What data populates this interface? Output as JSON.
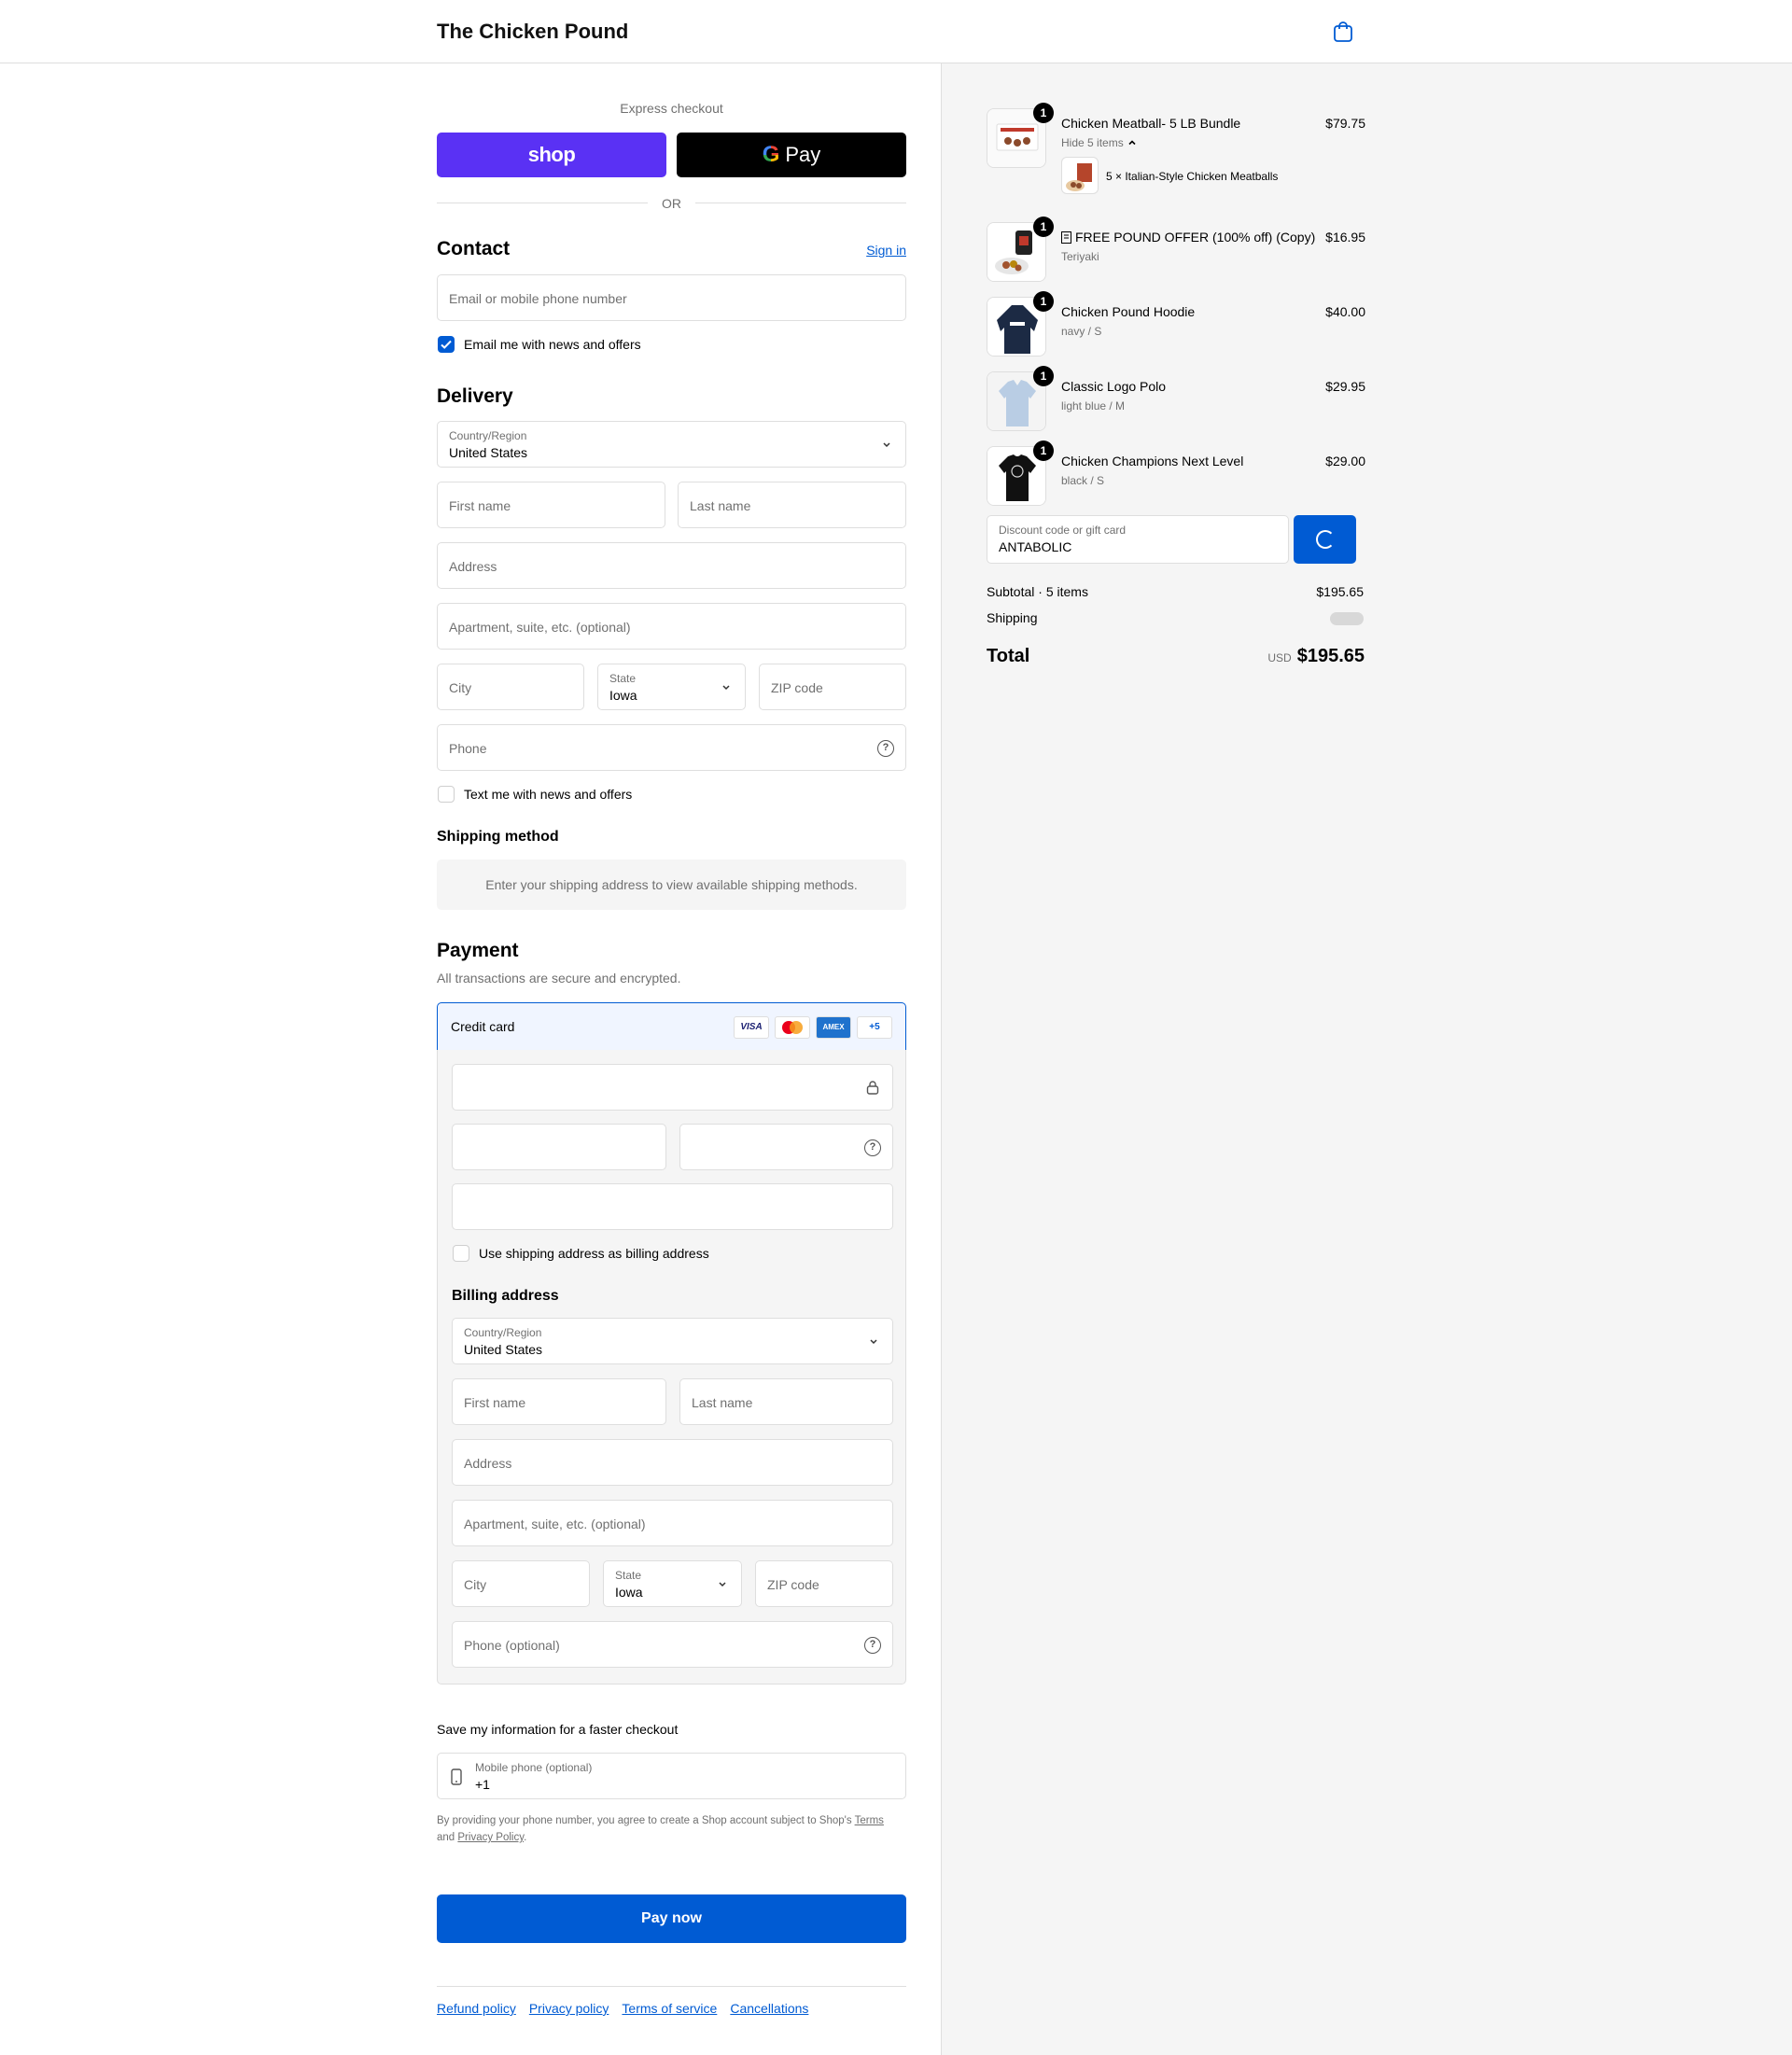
{
  "header": {
    "brand": "The Chicken Pound",
    "cart_icon": "shopping-bag-icon"
  },
  "express": {
    "label": "Express checkout",
    "shop_label": "shop",
    "gpay_g": "G",
    "gpay_label": "Pay",
    "or": "OR"
  },
  "contact": {
    "heading": "Contact",
    "sign_in": "Sign in",
    "email_placeholder": "Email or mobile phone number",
    "news_label": "Email me with news and offers",
    "news_checked": true
  },
  "delivery": {
    "heading": "Delivery",
    "country_label": "Country/Region",
    "country_value": "United States",
    "first_name": "First name",
    "last_name": "Last name",
    "address": "Address",
    "apartment": "Apartment, suite, etc. (optional)",
    "city": "City",
    "state_label": "State",
    "state_value": "Iowa",
    "zip": "ZIP code",
    "phone": "Phone",
    "text_label": "Text me with news and offers",
    "text_checked": false
  },
  "shipping_method": {
    "heading": "Shipping method",
    "message": "Enter your shipping address to view available shipping methods."
  },
  "payment": {
    "heading": "Payment",
    "subtitle": "All transactions are secure and encrypted.",
    "credit_card_label": "Credit card",
    "card_logos": [
      "VISA",
      "MC",
      "AMEX",
      "+5"
    ],
    "use_shipping_label": "Use shipping address as billing address",
    "billing_heading": "Billing address",
    "billing": {
      "country_label": "Country/Region",
      "country_value": "United States",
      "first_name": "First name",
      "last_name": "Last name",
      "address": "Address",
      "apartment": "Apartment, suite, etc. (optional)",
      "city": "City",
      "state_label": "State",
      "state_value": "Iowa",
      "zip": "ZIP code",
      "phone": "Phone (optional)"
    }
  },
  "save_info": {
    "heading": "Save my information for a faster checkout",
    "mobile_label": "Mobile phone (optional)",
    "mobile_value": "+1",
    "legal_prefix": "By providing your phone number, you agree to create a Shop account subject to Shop's ",
    "terms": "Terms",
    "and": "and",
    "privacy": "Privacy Policy",
    "period": "."
  },
  "pay_now": "Pay now",
  "footer_links": [
    "Refund policy",
    "Privacy policy",
    "Terms of service",
    "Cancellations"
  ],
  "order": {
    "items": [
      {
        "name": "Chicken Meatball- 5 LB Bundle",
        "variant": "Hide 5 items",
        "price": "$79.75",
        "qty": "1",
        "sub": "5 × Italian-Style Chicken Meatballs"
      },
      {
        "name": "FREE POUND OFFER (100% off) (Copy)",
        "variant": "Teriyaki",
        "price": "$16.95",
        "qty": "1"
      },
      {
        "name": "Chicken Pound Hoodie",
        "variant": "navy / S",
        "price": "$40.00",
        "qty": "1"
      },
      {
        "name": "Classic Logo Polo",
        "variant": "light blue / M",
        "price": "$29.95",
        "qty": "1"
      },
      {
        "name": "Chicken Champions Next Level",
        "variant": "black / S",
        "price": "$29.00",
        "qty": "1"
      }
    ],
    "discount_label": "Discount code or gift card",
    "discount_value": "ANTABOLIC",
    "subtotal_label": "Subtotal · 5 items",
    "subtotal_value": "$195.65",
    "shipping_label": "Shipping",
    "total_label": "Total",
    "currency": "USD",
    "total_value": "$195.65"
  }
}
